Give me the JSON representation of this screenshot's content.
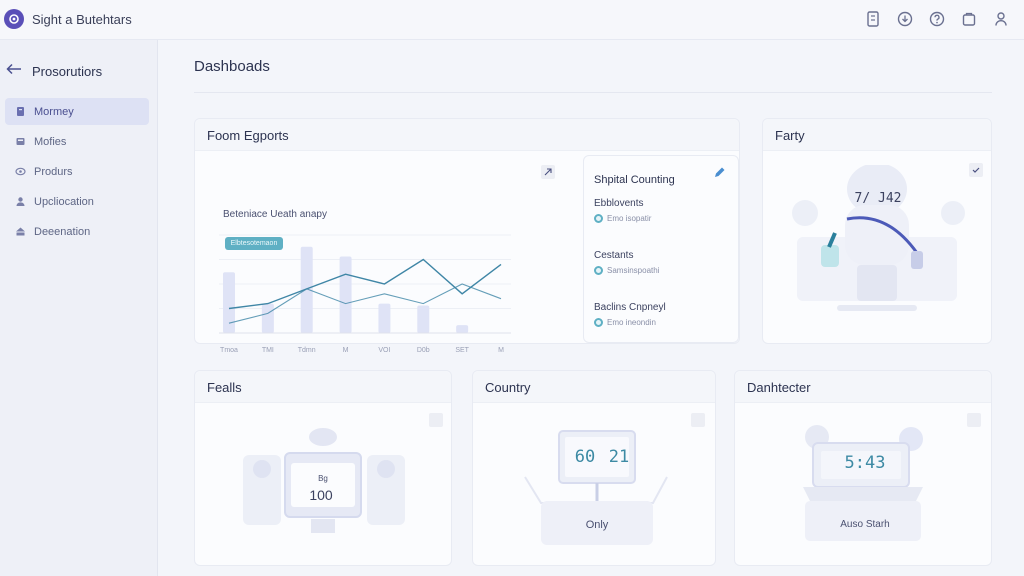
{
  "app": {
    "title": "Sight a Butehtars"
  },
  "sidebar": {
    "header": "Prosorutiors",
    "items": [
      {
        "label": "Mormey",
        "icon": "bookmark-icon",
        "active": true
      },
      {
        "label": "Mofies",
        "icon": "grid-icon",
        "active": false
      },
      {
        "label": "Produrs",
        "icon": "eye-icon",
        "active": false
      },
      {
        "label": "Upcliocation",
        "icon": "user-icon",
        "active": false
      },
      {
        "label": "Deeenation",
        "icon": "stack-icon",
        "active": false
      }
    ]
  },
  "page": {
    "title": "Dashboads"
  },
  "cards": {
    "exports": {
      "title": "Foom Egports",
      "chart_subtitle": "Beteniace Ueath anapy",
      "pill": "Elbtesotemaon"
    },
    "counting": {
      "title": "Shpital Counting",
      "stats": [
        {
          "label": "Ebblovents",
          "value": "Emo isopatir"
        },
        {
          "label": "Cestants",
          "value": "Samsinspoathi"
        },
        {
          "label": "Baclins Cnpneyl",
          "value": "Emo ineondin"
        }
      ]
    },
    "party": {
      "title": "Farty",
      "display": "7/ J42"
    },
    "fealls": {
      "title": "Fealls",
      "display": "100",
      "small": "Bg"
    },
    "country": {
      "title": "Country",
      "display_left": "60",
      "display_right": "21",
      "caption": "Only"
    },
    "danhtecter": {
      "title": "Danhtecter",
      "display": "5:43",
      "caption": "Auso Starh"
    }
  },
  "chart_data": {
    "type": "bar",
    "title": "Beteniace Ueath anapy",
    "categories": [
      "Tmoa",
      "TMI",
      "Tdmn",
      "M",
      "VOI",
      "D0b",
      "SET",
      "M"
    ],
    "values": [
      62,
      30,
      88,
      78,
      30,
      28,
      8
    ],
    "series": [
      {
        "name": "",
        "values": [
          25,
          30,
          45,
          60,
          50,
          75,
          40,
          70
        ]
      },
      {
        "name": "",
        "values": [
          10,
          20,
          45,
          30,
          40,
          30,
          50,
          35
        ]
      }
    ],
    "ylim": [
      0,
      100
    ],
    "grid": true
  },
  "colors": {
    "accent": "#5a4fb8",
    "bar": "#dfe3f6",
    "line": "#3f86a6",
    "teal": "#5fb0c4"
  }
}
